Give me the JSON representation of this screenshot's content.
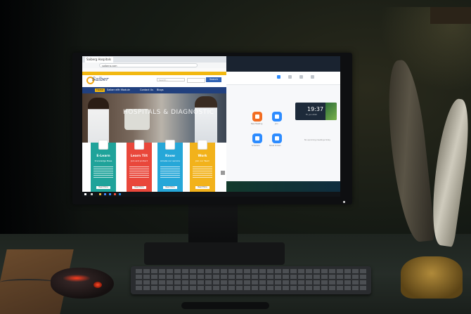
{
  "browser": {
    "tab_title": "Saiberg Hospitals",
    "url": "saiberg.com",
    "search_placeholder": "Search...",
    "search_button": "Search"
  },
  "site": {
    "logo_text": "Saiber",
    "nav": [
      "Home",
      "Saiber eMr Module",
      "Contact Us",
      "Blogs"
    ],
    "hero_title": "HOSPITALS & DIAGNOSTIC",
    "cards": [
      {
        "title": "E-Learn",
        "subtitle": "Knowledge Base",
        "button": "Read More"
      },
      {
        "title": "Learn Tilt",
        "subtitle": "Join and protect",
        "button": "Read More"
      },
      {
        "title": "Know",
        "subtitle": "Amelia our service",
        "button": "Read More"
      },
      {
        "title": "Work",
        "subtitle": "Join our Team",
        "button": "Read More"
      }
    ]
  },
  "zoom": {
    "time": "19:37",
    "actions": [
      "New Meeting",
      "Join",
      "Schedule",
      "Share Screen"
    ],
    "date": "Fri, Jun 2019",
    "empty_note": "No upcoming meetings today"
  },
  "colors": {
    "site_yellow": "#f2b811",
    "site_navy": "#21407e",
    "card_teal": "#1fa39a",
    "card_red": "#e9473b",
    "card_blue": "#26a7d8",
    "card_amber": "#f2b21b",
    "zoom_orange": "#f26d21",
    "zoom_blue": "#2d8cff",
    "mouse_glow": "#ff3c1e"
  }
}
